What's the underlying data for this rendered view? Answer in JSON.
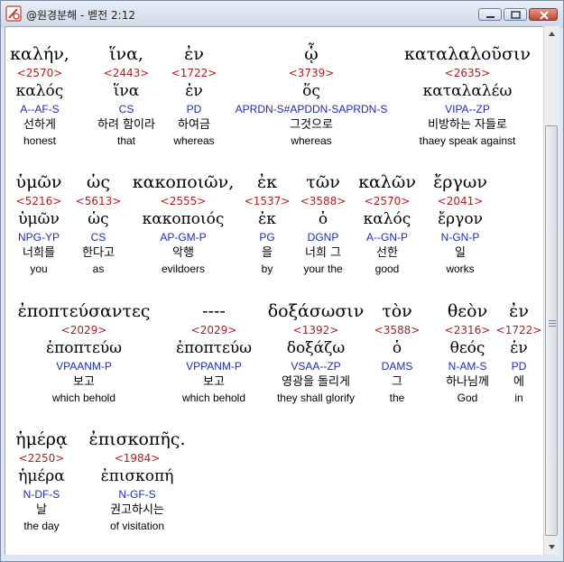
{
  "window": {
    "title": "@원경분해 - 벧전 2:12",
    "colors": {
      "greek": "#000000",
      "strongs": "#b01e1e",
      "parsing": "#1c2bb4"
    }
  },
  "verse_rows": [
    [
      {
        "greek": "καλήν,",
        "strongs": "<2570>",
        "lemma": "καλός",
        "parsing": "A--AF-S",
        "korean": "선하게",
        "english": "honest"
      },
      {
        "greek": "ἵνα,",
        "strongs": "<2443>",
        "lemma": "ἵνα",
        "parsing": "CS",
        "korean": "하려 함이라",
        "english": "that"
      },
      {
        "greek": "ἐν",
        "strongs": "<1722>",
        "lemma": "ἐν",
        "parsing": "PD",
        "korean": "하여금",
        "english": "whereas"
      },
      {
        "greek": "ᾧ",
        "strongs": "<3739>",
        "lemma": "ὅς",
        "parsing": "APRDN-S#APDDN-SAPRDN-S",
        "korean": "그것으로",
        "english": "whereas"
      },
      {
        "greek": "καταλαλοῦσιν",
        "strongs": "<2635>",
        "lemma": "καταλαλέω",
        "parsing": "VIPA--ZP",
        "korean": "비방하는 자들로",
        "english": "thaey speak against"
      }
    ],
    [
      {
        "greek": "ὑμῶν",
        "strongs": "<5216>",
        "lemma": "ὑμῶν",
        "parsing": "NPG-YP",
        "korean": "너희를",
        "english": "you"
      },
      {
        "greek": "ὡς",
        "strongs": "<5613>",
        "lemma": "ὡς",
        "parsing": "CS",
        "korean": "한다고",
        "english": "as"
      },
      {
        "greek": "κακοποιῶν,",
        "strongs": "<2555>",
        "lemma": "κακοποιός",
        "parsing": "AP-GM-P",
        "korean": "악행",
        "english": "evildoers"
      },
      {
        "greek": "ἐκ",
        "strongs": "<1537>",
        "lemma": "ἐκ",
        "parsing": "PG",
        "korean": "을",
        "english": "by"
      },
      {
        "greek": "τῶν",
        "strongs": "<3588>",
        "lemma": "ὁ",
        "parsing": "DGNP",
        "korean": "너희 그",
        "english": "your the"
      },
      {
        "greek": "καλῶν",
        "strongs": "<2570>",
        "lemma": "καλός",
        "parsing": "A--GN-P",
        "korean": "선한",
        "english": "good"
      },
      {
        "greek": "ἔργων",
        "strongs": "<2041>",
        "lemma": "ἔργον",
        "parsing": "N-GN-P",
        "korean": "일",
        "english": "works"
      }
    ],
    [
      {
        "greek": "ἐποπτεύσαντες",
        "strongs": "<2029>",
        "lemma": "ἐποπτεύω",
        "parsing": "VPAANM-P",
        "korean": "보고",
        "english": "which behold"
      },
      {
        "greek": "----",
        "strongs": "<2029>",
        "lemma": "ἐποπτεύω",
        "parsing": "VPPANM-P",
        "korean": "보고",
        "english": "which behold"
      },
      {
        "greek": "δοξάσωσιν",
        "strongs": "<1392>",
        "lemma": "δοξάζω",
        "parsing": "VSAA--ZP",
        "korean": "영광을 돌리게",
        "english": "they shall glorify"
      },
      {
        "greek": "τὸν",
        "strongs": "<3588>",
        "lemma": "ὁ",
        "parsing": "DAMS",
        "korean": "그",
        "english": "the"
      },
      {
        "greek": "θεὸν",
        "strongs": "<2316>",
        "lemma": "θεός",
        "parsing": "N-AM-S",
        "korean": "하나님께",
        "english": "God"
      },
      {
        "greek": "ἐν",
        "strongs": "<1722>",
        "lemma": "ἐν",
        "parsing": "PD",
        "korean": "에",
        "english": "in"
      }
    ],
    [
      {
        "greek": "ἡμέρᾳ",
        "strongs": "<2250>",
        "lemma": "ἡμέρα",
        "parsing": "N-DF-S",
        "korean": "날",
        "english": "the day"
      },
      {
        "greek": "ἐπισκοπῆς.",
        "strongs": "<1984>",
        "lemma": "ἐπισκοπή",
        "parsing": "N-GF-S",
        "korean": "권고하시는",
        "english": "of visitation"
      }
    ]
  ]
}
